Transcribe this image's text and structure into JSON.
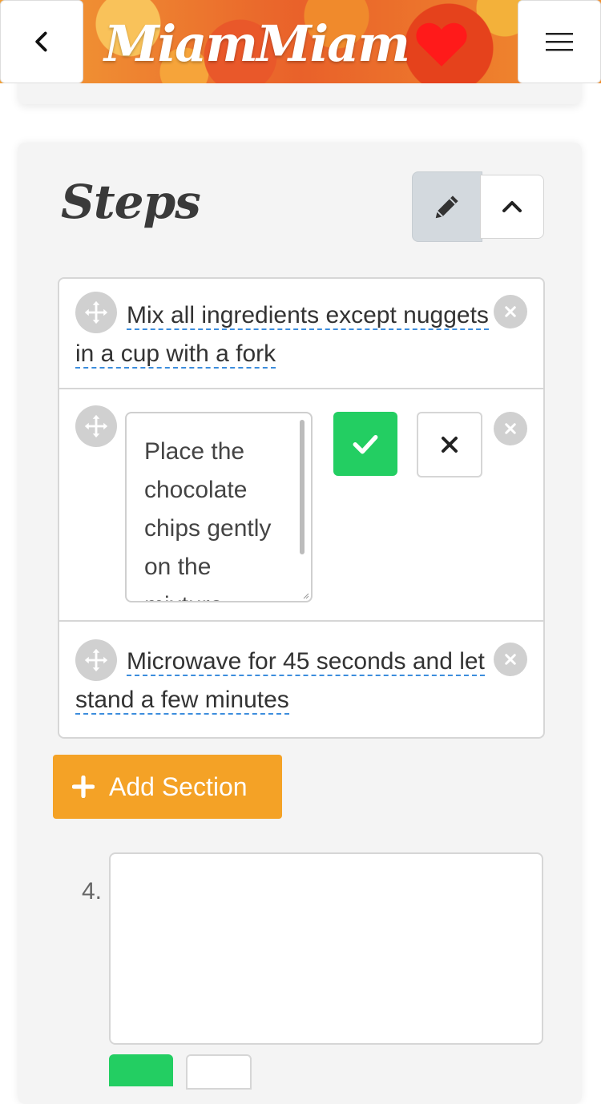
{
  "header": {
    "app_name": "MiamMiam",
    "back_icon": "chevron-left-icon",
    "menu_icon": "hamburger-icon",
    "heart_color": "#ff1a1a"
  },
  "steps_section": {
    "title": "Steps",
    "edit_icon": "pencil-icon",
    "collapse_icon": "chevron-up-icon",
    "steps": [
      {
        "text": "Mix all ingredients except nuggets in a cup with a fork"
      },
      {
        "text": "Place the chocolate chips gently on the mixture",
        "editing": true
      },
      {
        "text": "Microwave for 45 seconds and let stand a few minutes"
      }
    ],
    "add_section_label": "Add Section",
    "new_step": {
      "number": "4.",
      "value": ""
    }
  },
  "colors": {
    "confirm": "#23ce62",
    "add_section": "#f4a226",
    "link_underline": "#3c8ddd"
  }
}
